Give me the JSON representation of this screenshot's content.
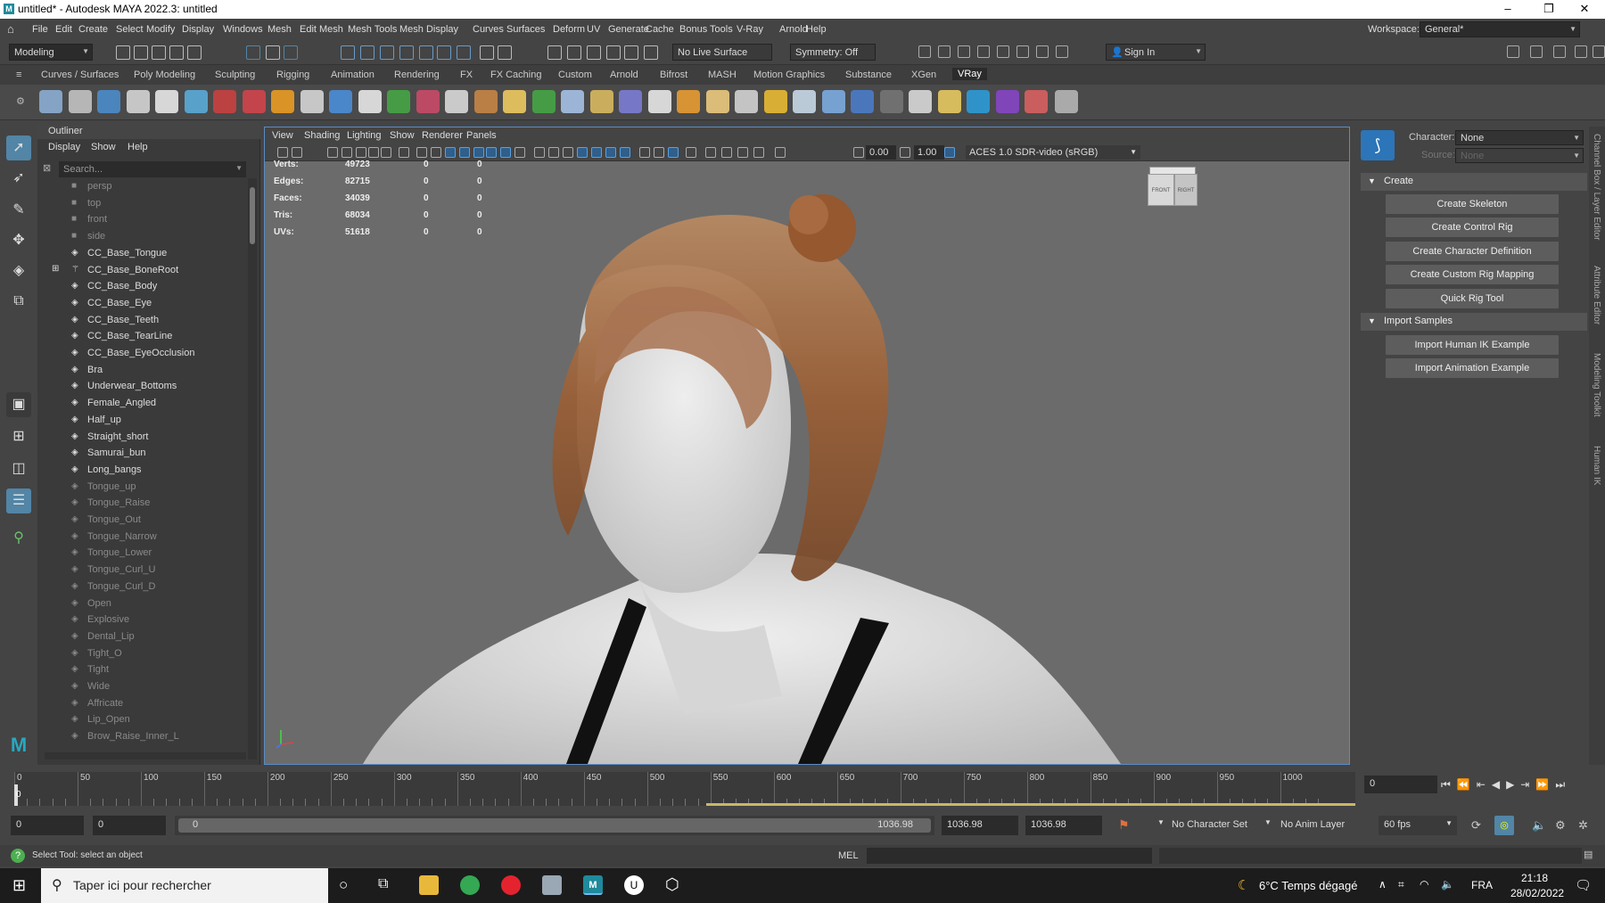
{
  "window": {
    "title": "untitled* - Autodesk MAYA 2022.3: untitled",
    "minimize": "–",
    "restore": "❐",
    "close": "✕"
  },
  "menubar": [
    "File",
    "Edit",
    "Create",
    "Select",
    "Modify",
    "Display",
    "Windows",
    "Mesh",
    "Edit Mesh",
    "Mesh Tools",
    "Mesh Display",
    "Curves",
    "Surfaces",
    "Deform",
    "UV",
    "Generate",
    "Cache",
    "Bonus Tools",
    "V-Ray",
    "Arnold",
    "Help"
  ],
  "workspace": {
    "label": "Workspace:",
    "value": "General*"
  },
  "statusline": {
    "mode": "Modeling",
    "live_surface": "No Live Surface",
    "symmetry": "Symmetry: Off",
    "sign_in": "Sign In"
  },
  "shelf_tabs": [
    "Curves / Surfaces",
    "Poly Modeling",
    "Sculpting",
    "Rigging",
    "Animation",
    "Rendering",
    "FX",
    "FX Caching",
    "Custom",
    "Arnold",
    "Bifrost",
    "MASH",
    "Motion Graphics",
    "Substance",
    "XGen",
    "VRay"
  ],
  "shelf_active": "VRay",
  "outliner": {
    "title": "Outliner",
    "menu": [
      "Display",
      "Show",
      "Help"
    ],
    "search_placeholder": "Search...",
    "items": [
      {
        "label": "persp",
        "dim": true,
        "icon": "camera-icon"
      },
      {
        "label": "top",
        "dim": true,
        "icon": "camera-icon"
      },
      {
        "label": "front",
        "dim": true,
        "icon": "camera-icon"
      },
      {
        "label": "side",
        "dim": true,
        "icon": "camera-icon"
      },
      {
        "label": "CC_Base_Tongue",
        "dim": false,
        "icon": "mesh-icon"
      },
      {
        "label": "CC_Base_BoneRoot",
        "dim": false,
        "icon": "joint-icon",
        "expand": true
      },
      {
        "label": "CC_Base_Body",
        "dim": false,
        "icon": "mesh-icon"
      },
      {
        "label": "CC_Base_Eye",
        "dim": false,
        "icon": "mesh-icon"
      },
      {
        "label": "CC_Base_Teeth",
        "dim": false,
        "icon": "mesh-icon"
      },
      {
        "label": "CC_Base_TearLine",
        "dim": false,
        "icon": "mesh-icon"
      },
      {
        "label": "CC_Base_EyeOcclusion",
        "dim": false,
        "icon": "mesh-icon"
      },
      {
        "label": "Bra",
        "dim": false,
        "icon": "mesh-icon"
      },
      {
        "label": "Underwear_Bottoms",
        "dim": false,
        "icon": "mesh-icon"
      },
      {
        "label": "Female_Angled",
        "dim": false,
        "icon": "mesh-icon"
      },
      {
        "label": "Half_up",
        "dim": false,
        "icon": "mesh-icon"
      },
      {
        "label": "Straight_short",
        "dim": false,
        "icon": "mesh-icon"
      },
      {
        "label": "Samurai_bun",
        "dim": false,
        "icon": "mesh-icon"
      },
      {
        "label": "Long_bangs",
        "dim": false,
        "icon": "mesh-icon"
      },
      {
        "label": "Tongue_up",
        "dim": true,
        "icon": "mesh-icon"
      },
      {
        "label": "Tongue_Raise",
        "dim": true,
        "icon": "mesh-icon"
      },
      {
        "label": "Tongue_Out",
        "dim": true,
        "icon": "mesh-icon"
      },
      {
        "label": "Tongue_Narrow",
        "dim": true,
        "icon": "mesh-icon"
      },
      {
        "label": "Tongue_Lower",
        "dim": true,
        "icon": "mesh-icon"
      },
      {
        "label": "Tongue_Curl_U",
        "dim": true,
        "icon": "mesh-icon"
      },
      {
        "label": "Tongue_Curl_D",
        "dim": true,
        "icon": "mesh-icon"
      },
      {
        "label": "Open",
        "dim": true,
        "icon": "mesh-icon"
      },
      {
        "label": "Explosive",
        "dim": true,
        "icon": "mesh-icon"
      },
      {
        "label": "Dental_Lip",
        "dim": true,
        "icon": "mesh-icon"
      },
      {
        "label": "Tight_O",
        "dim": true,
        "icon": "mesh-icon"
      },
      {
        "label": "Tight",
        "dim": true,
        "icon": "mesh-icon"
      },
      {
        "label": "Wide",
        "dim": true,
        "icon": "mesh-icon"
      },
      {
        "label": "Affricate",
        "dim": true,
        "icon": "mesh-icon"
      },
      {
        "label": "Lip_Open",
        "dim": true,
        "icon": "mesh-icon"
      },
      {
        "label": "Brow_Raise_Inner_L",
        "dim": true,
        "icon": "mesh-icon"
      }
    ]
  },
  "viewport": {
    "menu": [
      "View",
      "Shading",
      "Lighting",
      "Show",
      "Renderer",
      "Panels"
    ],
    "exposure": "0.00",
    "gamma": "1.00",
    "color_space": "ACES 1.0 SDR-video (sRGB)",
    "viewcube_front": "FRONT",
    "viewcube_right": "RIGHT",
    "hud": [
      {
        "label": "Verts:",
        "v1": "49723",
        "v2": "0",
        "v3": "0"
      },
      {
        "label": "Edges:",
        "v1": "82715",
        "v2": "0",
        "v3": "0"
      },
      {
        "label": "Faces:",
        "v1": "34039",
        "v2": "0",
        "v3": "0"
      },
      {
        "label": "Tris:",
        "v1": "68034",
        "v2": "0",
        "v3": "0"
      },
      {
        "label": "UVs:",
        "v1": "51618",
        "v2": "0",
        "v3": "0"
      }
    ]
  },
  "humanik": {
    "character_label": "Character:",
    "character_value": "None",
    "source_label": "Source:",
    "source_value": "None",
    "create_header": "Create",
    "create_buttons": [
      "Create Skeleton",
      "Create Control Rig",
      "Create Character Definition",
      "Create Custom Rig Mapping",
      "Quick Rig Tool"
    ],
    "import_header": "Import Samples",
    "import_buttons": [
      "Import Human IK Example",
      "Import Animation Example"
    ]
  },
  "side_tabs": [
    "Channel Box / Layer Editor",
    "Attribute Editor",
    "Modeling Toolkit",
    "Human IK"
  ],
  "timeline": {
    "ticks": [
      "0",
      "50",
      "100",
      "150",
      "200",
      "250",
      "300",
      "350",
      "400",
      "450",
      "500",
      "550",
      "600",
      "650",
      "700",
      "750",
      "800",
      "850",
      "900",
      "950",
      "1000"
    ],
    "current_frame": "0",
    "current_frame_field": "0"
  },
  "range": {
    "start": "0",
    "playback_start": "0",
    "slider_start": "0",
    "slider_end": "1036.98",
    "playback_end": "1036.98",
    "end": "1036.98",
    "character_set": "No Character Set",
    "anim_layer": "No Anim Layer",
    "fps": "60 fps"
  },
  "helpline": {
    "text": "Select Tool: select an object",
    "mel": "MEL"
  },
  "taskbar": {
    "search_placeholder": "Taper ici pour rechercher",
    "weather": "6°C  Temps dégagé",
    "language": "FRA",
    "time": "21:18",
    "date": "28/02/2022"
  },
  "colors": {
    "accent": "#5285a6",
    "viewport_bg": "#6b6b6b",
    "hair": "#8a5230",
    "skin": "#e6e6e6"
  }
}
